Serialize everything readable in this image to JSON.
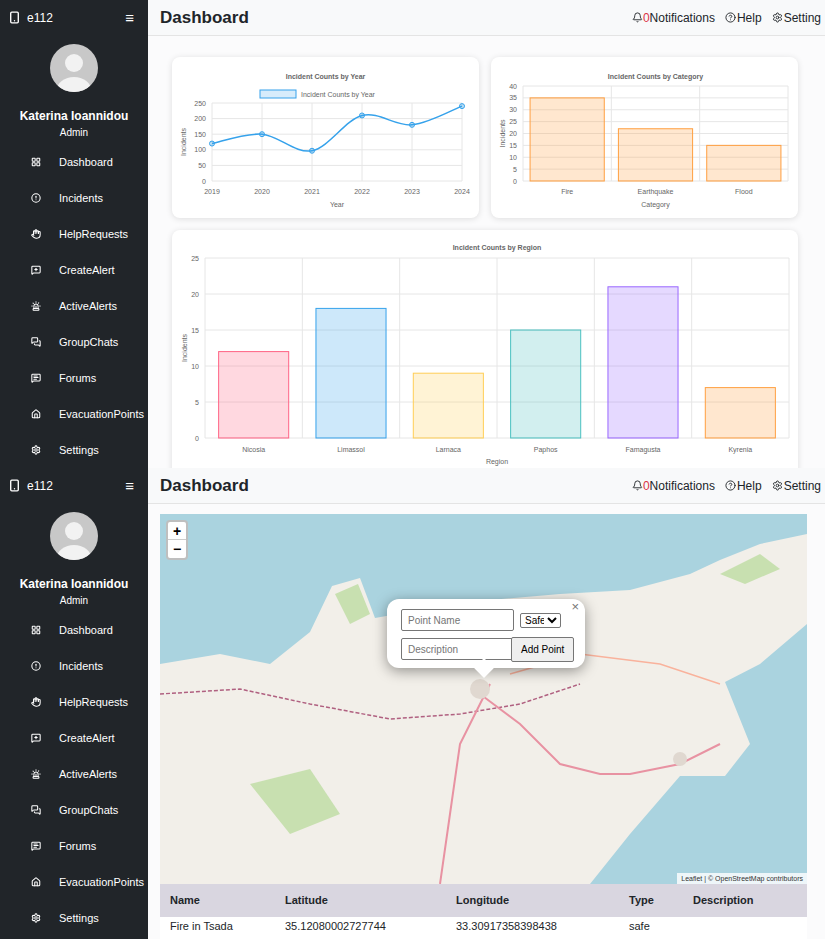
{
  "app": {
    "brand": "e112",
    "menu_glyph": "≡",
    "user": {
      "name": "Katerina Ioannidou",
      "role": "Admin"
    },
    "sidebar": {
      "items": [
        {
          "label": "Dashboard"
        },
        {
          "label": "Incidents"
        },
        {
          "label": "HelpRequests"
        },
        {
          "label": "CreateAlert"
        },
        {
          "label": "ActiveAlerts"
        },
        {
          "label": "GroupChats"
        },
        {
          "label": "Forums"
        },
        {
          "label": "EvacuationPoints"
        },
        {
          "label": "Settings"
        }
      ]
    },
    "header": {
      "title": "Dashboard",
      "notifications": {
        "count": "0",
        "label": "Notifications"
      },
      "help": "Help",
      "setting": "Setting"
    }
  },
  "screens": [
    {
      "kind": "charts",
      "line_chart": {
        "title": "Incident Counts by Year",
        "legend": "Incident Counts by Year",
        "y_axis": {
          "label": "Incidents",
          "ticks": [
            "0",
            "50",
            "100",
            "150",
            "200",
            "250"
          ]
        },
        "x_axis": {
          "label": "Year",
          "ticks": [
            "2019",
            "2020",
            "2021",
            "2022",
            "2023",
            "2024"
          ]
        },
        "series": [
          {
            "values": [
              120,
              150,
              97,
              210,
              180,
              240
            ],
            "color": "#36a2eb"
          }
        ]
      },
      "category_chart": {
        "title": "Incident Counts by Category",
        "y_axis": {
          "label": "Incidents",
          "ticks": [
            "0",
            "5",
            "10",
            "15",
            "20",
            "25",
            "30",
            "35",
            "40"
          ]
        },
        "x_axis": {
          "label": "Category",
          "ticks": [
            "Fire",
            "Earthquake",
            "Flood"
          ]
        },
        "series": [
          {
            "values": [
              35,
              22,
              15
            ],
            "colors": [
              "#ff9f40",
              "#ff9f40",
              "#ff9f40"
            ]
          }
        ]
      },
      "region_chart": {
        "title": "Incident Counts by Region",
        "y_axis": {
          "label": "Incidents",
          "ticks": [
            "0",
            "5",
            "10",
            "15",
            "20",
            "25"
          ]
        },
        "x_axis": {
          "label": "Region",
          "ticks": [
            "Nicosia",
            "Limassol",
            "Larnaca",
            "Paphos",
            "Famagusta",
            "Kyrenia"
          ]
        },
        "series": [
          {
            "values": [
              12,
              18,
              9,
              15,
              21,
              7
            ],
            "colors": [
              "#ff6384",
              "#36a2eb",
              "#ffce56",
              "#4bc0c0",
              "#9966ff",
              "#ff9f40"
            ]
          }
        ]
      }
    },
    {
      "kind": "map",
      "map": {
        "zoom_in": "+",
        "zoom_out": "−",
        "attribution": "Leaflet | © OpenStreetMap contributors",
        "popup": {
          "close": "×",
          "name_placeholder": "Point Name",
          "type": "Safe",
          "description_placeholder": "Description",
          "button": "Add Point"
        }
      },
      "table": {
        "columns": [
          "Name",
          "Latitude",
          "Longitude",
          "Type",
          "Description"
        ],
        "rows": [
          [
            "Fire in Tsada",
            "35.12080002727744",
            "33.30917358398438",
            "safe",
            ""
          ]
        ]
      }
    }
  ]
}
